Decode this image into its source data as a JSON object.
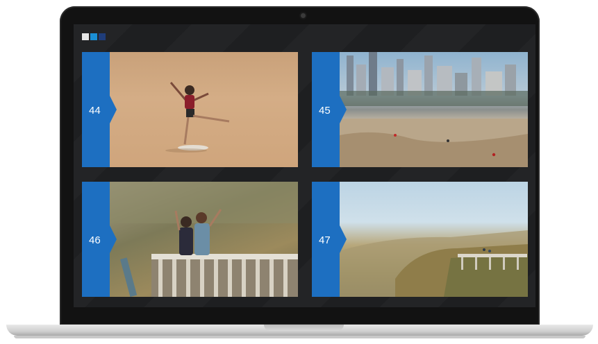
{
  "screen": {
    "indicator_squares": [
      {
        "name": "indicator-square-light",
        "color": "#e6e6e6"
      },
      {
        "name": "indicator-square-blue",
        "color": "#1a8fd6"
      },
      {
        "name": "indicator-square-navy",
        "color": "#1f3d7a"
      }
    ],
    "tiles": [
      {
        "number": "44",
        "image": "beach-dancer-photo"
      },
      {
        "number": "45",
        "image": "city-beach-photo"
      },
      {
        "number": "46",
        "image": "cliff-couple-photo"
      },
      {
        "number": "47",
        "image": "coastal-cliff-photo"
      }
    ],
    "accent_color": "#1d6fc1"
  }
}
